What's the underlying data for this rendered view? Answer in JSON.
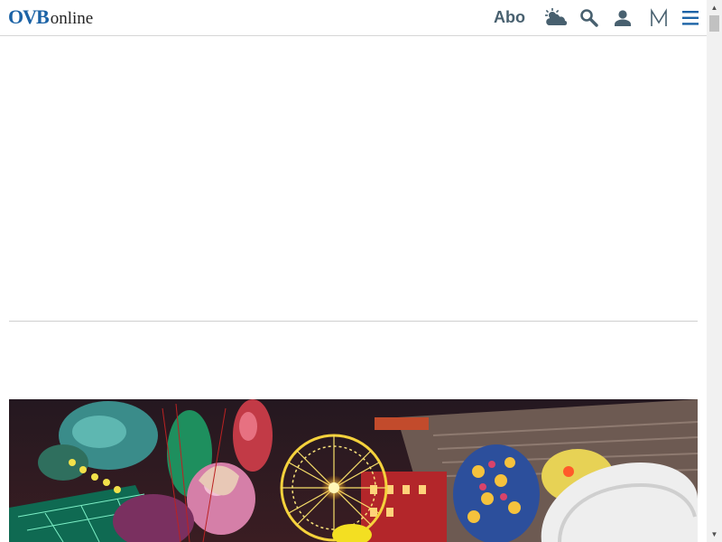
{
  "header": {
    "logo_ovb": "OVB",
    "logo_online": "online",
    "abo_label": "Abo"
  },
  "icons": {
    "weather": "weather-icon",
    "search": "search-icon",
    "user": "user-icon",
    "merkur": "merkur-icon",
    "menu": "menu-icon"
  },
  "colors": {
    "brand_blue": "#1c63a6",
    "header_text": "#48606f",
    "divider": "#cfcfcf"
  },
  "hero_image": {
    "subject": "hero-photo"
  }
}
